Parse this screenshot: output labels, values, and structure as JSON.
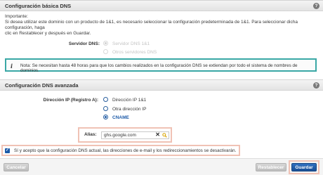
{
  "basic": {
    "title": "Configuración básica DNS",
    "intro_heading": "Importante:",
    "intro_line1": "Si desea utilizar este dominio con un producto de 1&1, es necesario seleccionar la configuración predeterminada de 1&1. Para seleccionar dicha configuración, haga",
    "intro_line2": "clic en Restablecer y después en Guardar.",
    "server_label": "Servidor DNS:",
    "server_options": [
      "Servidor DNS 1&1",
      "Otros servidores DNS"
    ],
    "note": "Nota: Se necesitan hasta 48 horas para que los cambios realizados en la configuración DNS se extiendan por todo el sistema de nombres de dominios."
  },
  "advanced": {
    "title": "Configuración DNS avanzada",
    "ip_label": "Dirección IP (Registro A):",
    "ip_options": [
      "Dirección IP 1&1",
      "Otra dirección IP",
      "CNAME"
    ],
    "alias_label": "Alias:",
    "alias_value": "ghs.google.com",
    "accept_text": "Sí y acepto que la configuración DNS actual, las direcciones de e-mail y los redireccionamientos se desactivarán."
  },
  "footer": {
    "cancel": "Cancelar",
    "reset": "Restablecer",
    "save": "Guardar"
  },
  "colors": {
    "accent": "#1c5aa8",
    "note_border": "#3aa8a6",
    "highlight": "#f0c2b5"
  }
}
